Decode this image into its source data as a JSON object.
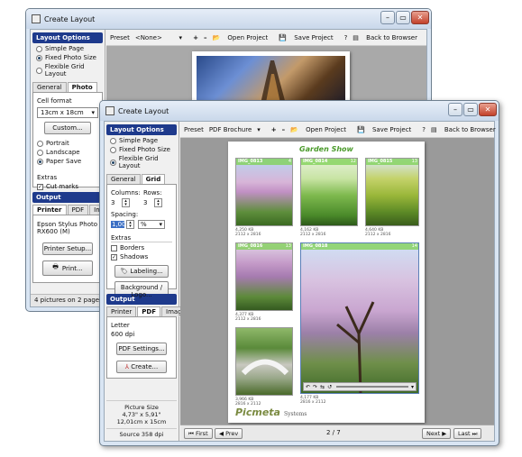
{
  "back_window": {
    "title": "Create Layout",
    "layout_options": {
      "heading": "Layout Options",
      "options": [
        "Simple Page",
        "Fixed Photo Size",
        "Flexible Grid Layout"
      ],
      "selected": 1
    },
    "tabs": [
      "General",
      "Photo"
    ],
    "active_tab": 1,
    "cell_format_label": "Cell format",
    "cell_format_value": "13cm x 18cm",
    "custom_button": "Custom...",
    "orientation": [
      "Portrait",
      "Landscape",
      "Paper Save"
    ],
    "orientation_selected": 2,
    "extras_label": "Extras",
    "cut_marks_label": "Cut marks",
    "output": {
      "heading": "Output",
      "tabs": [
        "Printer",
        "PDF",
        "Image"
      ],
      "printer_name": "Epson Stylus Photo RX600 (M)",
      "printer_setup_button": "Printer Setup...",
      "print_button": "Print..."
    },
    "status": "4 pictures on 2 pages",
    "toolbar": {
      "preset_label": "Preset",
      "preset_value": "<None>",
      "open_project": "Open Project",
      "save_project": "Save Project",
      "back_to_browser": "Back to Browser"
    }
  },
  "front_window": {
    "title": "Create Layout",
    "layout_options": {
      "heading": "Layout Options",
      "options": [
        "Simple Page",
        "Fixed Photo Size",
        "Flexible Grid Layout"
      ],
      "selected": 2
    },
    "tabs": [
      "General",
      "Grid"
    ],
    "active_tab": 1,
    "columns_label": "Columns:",
    "columns_value": "3",
    "rows_label": "Rows:",
    "rows_value": "3",
    "spacing_label": "Spacing:",
    "spacing_value": "1,00",
    "spacing_unit": "%",
    "extras_label": "Extras",
    "borders_label": "Borders",
    "shadows_label": "Shadows",
    "labeling_button": "Labeling...",
    "background_logo_button": "Background / Logo...",
    "output": {
      "heading": "Output",
      "tabs": [
        "Printer",
        "PDF",
        "Image"
      ],
      "active_tab": 1,
      "paper": "Letter",
      "dpi": "600 dpi",
      "pdf_settings_button": "PDF Settings...",
      "create_button": "Create..."
    },
    "picture_size": {
      "label": "Picture Size",
      "inches": "4,73\" x 5,91\"",
      "cm": "12,01cm x 15cm",
      "source": "Source 358 dpi"
    },
    "toolbar": {
      "preset_label": "Preset",
      "preset_value": "PDF Brochure",
      "open_project": "Open Project",
      "save_project": "Save Project",
      "back_to_browser": "Back to Browser"
    },
    "page": {
      "title": "Garden Show",
      "logo_main": "Picmeta",
      "logo_sub": "Systems",
      "photos": [
        {
          "label": "IMG_0813",
          "num": "4",
          "size": "4,250 KB",
          "date": "2112 x 2816"
        },
        {
          "label": "IMG_0814",
          "num": "12",
          "size": "4,162 KB",
          "date": "2112 x 2816"
        },
        {
          "label": "IMG_0815",
          "num": "13",
          "size": "4,640 KB",
          "date": "2112 x 2816"
        },
        {
          "label": "IMG_0816",
          "num": "13",
          "size": "4,377 KB",
          "date": "2112 x 2816"
        },
        {
          "label": "IMG_0818",
          "num": "14",
          "size": "4,177 KB",
          "date": "2816 x 2112"
        },
        {
          "label": "",
          "num": "",
          "size": "3,966 KB",
          "date": "2816 x 2112"
        }
      ]
    },
    "nav": {
      "first": "First",
      "prev": "Prev",
      "page_indicator": "2 / 7",
      "next": "Next",
      "last": "Last"
    }
  }
}
